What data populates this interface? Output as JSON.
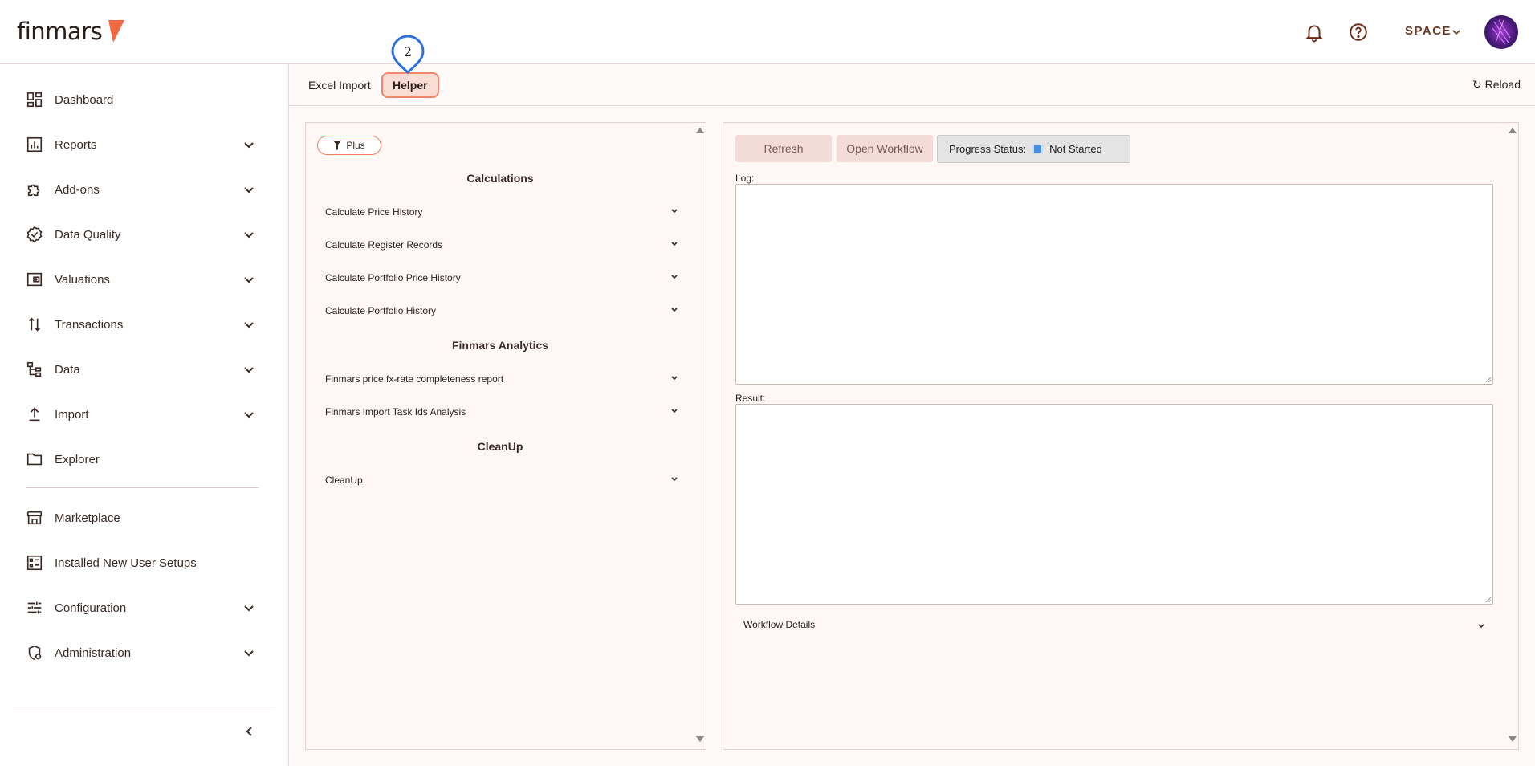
{
  "app": {
    "logo_text": "finmars",
    "space_label": "SPACE",
    "brand_color": "#f0693f"
  },
  "sidebar": {
    "items": [
      {
        "label": "Dashboard",
        "icon": "dashboard-icon",
        "has_chevron": false
      },
      {
        "label": "Reports",
        "icon": "reports-icon",
        "has_chevron": true
      },
      {
        "label": "Add-ons",
        "icon": "puzzle-icon",
        "has_chevron": true
      },
      {
        "label": "Data Quality",
        "icon": "badge-check-icon",
        "has_chevron": true
      },
      {
        "label": "Valuations",
        "icon": "wallet-icon",
        "has_chevron": true
      },
      {
        "label": "Transactions",
        "icon": "swap-icon",
        "has_chevron": true
      },
      {
        "label": "Data",
        "icon": "hierarchy-icon",
        "has_chevron": true
      },
      {
        "label": "Import",
        "icon": "upload-icon",
        "has_chevron": true
      },
      {
        "label": "Explorer",
        "icon": "folder-icon",
        "has_chevron": false
      },
      {
        "label": "Marketplace",
        "icon": "store-icon",
        "has_chevron": false
      },
      {
        "label": "Installed New User Setups",
        "icon": "list-box-icon",
        "has_chevron": false
      },
      {
        "label": "Configuration",
        "icon": "sliders-icon",
        "has_chevron": true
      },
      {
        "label": "Administration",
        "icon": "admin-gear-icon",
        "has_chevron": true
      }
    ]
  },
  "tabs": {
    "excel_import": "Excel Import",
    "helper": "Helper",
    "pin_number": "2",
    "reload": "↻ Reload"
  },
  "left_panel": {
    "filter_label": "Plus",
    "sections": [
      {
        "title": "Calculations",
        "items": [
          "Calculate Price History",
          "Calculate Register Records",
          "Calculate Portfolio Price History",
          "Calculate Portfolio History"
        ]
      },
      {
        "title": "Finmars Analytics",
        "items": [
          "Finmars price fx-rate completeness report",
          "Finmars Import Task Ids Analysis"
        ]
      },
      {
        "title": "CleanUp",
        "items": [
          "CleanUp"
        ]
      }
    ]
  },
  "right_panel": {
    "refresh_label": "Refresh",
    "open_workflow_label": "Open Workflow",
    "progress_status_label": "Progress Status:",
    "progress_status_value": "Not Started",
    "log_label": "Log:",
    "result_label": "Result:",
    "log_value": "",
    "result_value": "",
    "workflow_details_label": "Workflow Details"
  }
}
